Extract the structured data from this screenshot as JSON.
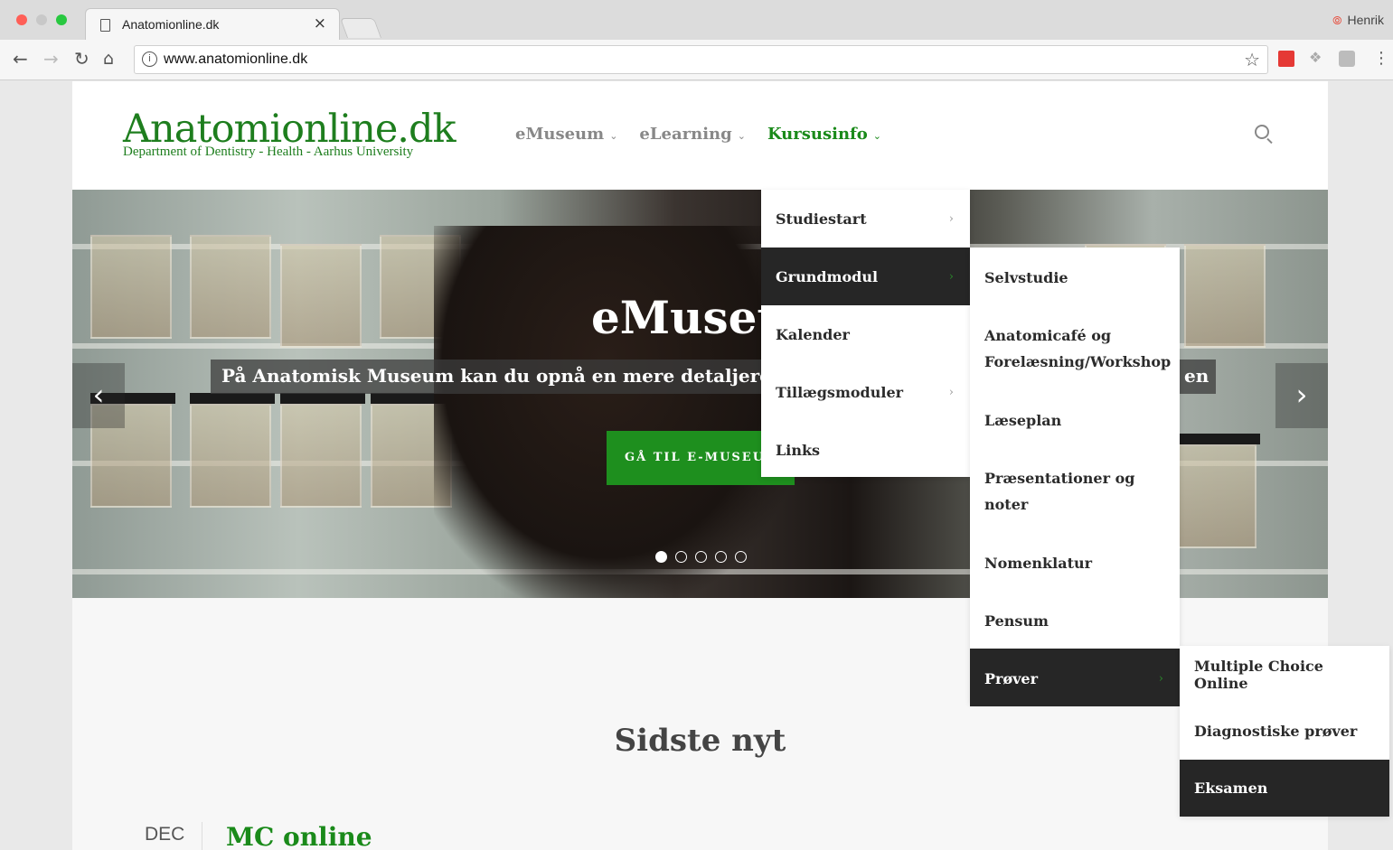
{
  "browser": {
    "tab_title": "Anatomionline.dk",
    "tab_close": "×",
    "profile_name": "Henrik",
    "url": "www.anatomionline.dk",
    "info_glyph": "i",
    "icons": [
      "back-arrow-icon",
      "forward-arrow-icon",
      "reload-icon",
      "home-icon",
      "bookmark-star-icon",
      "menu-dots-icon"
    ]
  },
  "header": {
    "logo_title": "Anatomionline.dk",
    "logo_subtitle": "Department of Dentistry - Health - Aarhus University",
    "nav": [
      {
        "label": "eMuseum",
        "active": false
      },
      {
        "label": "eLearning",
        "active": false
      },
      {
        "label": "Kursusinfo",
        "active": true
      }
    ]
  },
  "hero": {
    "title": "eMuseu",
    "caption": "På Anatomisk Museum kan du opnå en mere detaljeret",
    "caption_tail": "en",
    "button_label": "GÅ TIL E-MUSEU",
    "slide_count": 5,
    "active_slide": 1
  },
  "menu_level1": [
    {
      "label": "Studiestart",
      "has_submenu": true,
      "active": false
    },
    {
      "label": "Grundmodul",
      "has_submenu": true,
      "active": true
    },
    {
      "label": "Kalender",
      "has_submenu": false,
      "active": false
    },
    {
      "label": "Tillægsmoduler",
      "has_submenu": true,
      "active": false
    },
    {
      "label": "Links",
      "has_submenu": false,
      "active": false
    }
  ],
  "menu_level2": [
    {
      "label": "Selvstudie",
      "active": false
    },
    {
      "label": "Anatomicafé og Forelæsning/Workshop",
      "active": false
    },
    {
      "label": "Læseplan",
      "active": false
    },
    {
      "label": "Præsentationer og noter",
      "active": false
    },
    {
      "label": "Nomenklatur",
      "active": false
    },
    {
      "label": "Pensum",
      "active": false
    },
    {
      "label": "Prøver",
      "active": true
    }
  ],
  "menu_level3": [
    {
      "label": "Multiple Choice Online",
      "active": false
    },
    {
      "label": "Diagnostiske prøver",
      "active": false
    },
    {
      "label": "Eksamen",
      "active": true
    }
  ],
  "news": {
    "section_title": "Sidste nyt",
    "month": "DEC",
    "headline": "MC online"
  },
  "colors": {
    "brand_green": "#1e7e1e",
    "menu_active_bg": "#262626"
  }
}
